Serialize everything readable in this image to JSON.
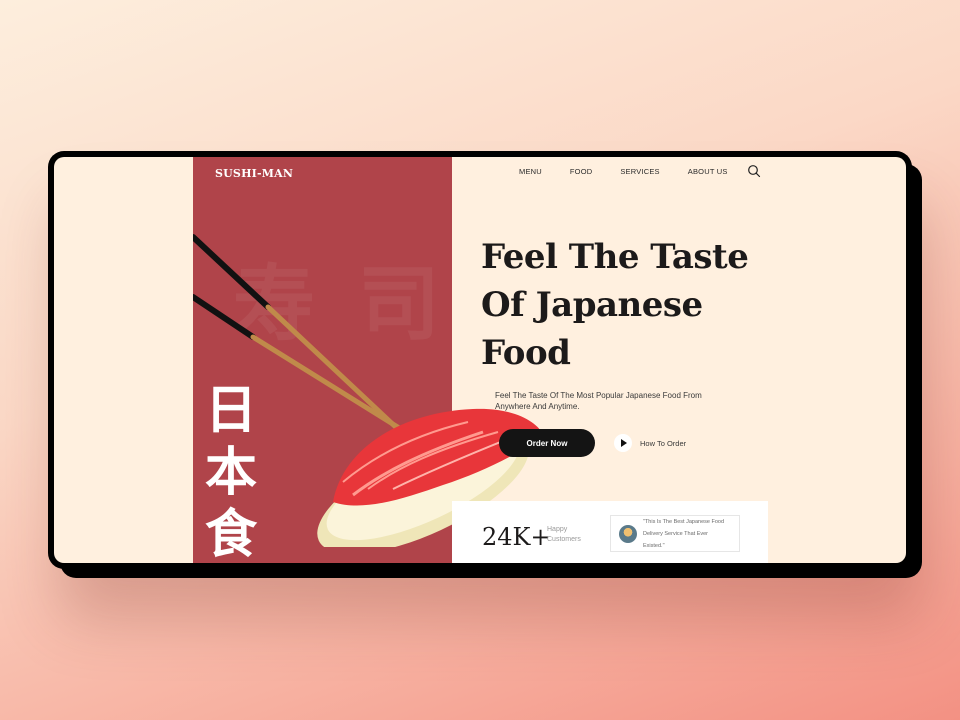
{
  "brand": "SUSHI-MAN",
  "nav": {
    "items": [
      "MENU",
      "FOOD",
      "SERVICES",
      "ABOUT US"
    ]
  },
  "hero": {
    "title_line1": "Feel The Taste",
    "title_line2": "Of Japanese",
    "title_line3": "Food",
    "subtitle_line1": "Feel The Taste Of The Most Popular Japanese Food From",
    "subtitle_line2": "Anywhere And Anytime.",
    "cta_label": "Order Now",
    "secondary_label": "How To Order"
  },
  "kanji": {
    "vertical": [
      "日",
      "本",
      "食"
    ],
    "background": [
      "寿",
      "司"
    ]
  },
  "stats": {
    "number": "24K+",
    "label_line1": "Happy",
    "label_line2": "Customers"
  },
  "testimonial": {
    "quote_line1": "\"This Is The Best Japanese Food",
    "quote_line2": "Delivery Service That Ever Existed.\""
  },
  "colors": {
    "accent_red": "#b0444a",
    "cream": "#fff0df",
    "dark": "#141414"
  },
  "icons": {
    "search": "search-icon",
    "play": "play-icon"
  }
}
